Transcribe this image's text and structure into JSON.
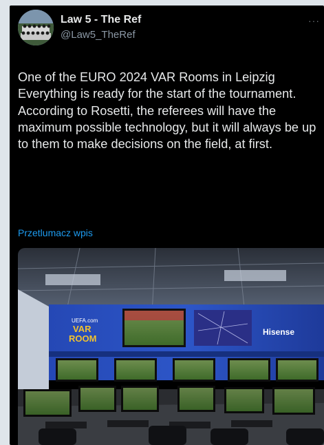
{
  "author": {
    "name": "Law 5 - The Ref",
    "handle": "@Law5_TheRef"
  },
  "more_label": "···",
  "tweet_text": "One of the EURO 2024 VAR Rooms in Leipzig\nEverything is ready for the start of the tournament.\nAccording to Rosetti, the referees will have the maximum possible technology, but it will always be up to them to make decisions on the field, at first.",
  "translate_link": "Przetlumacz wpis",
  "media": {
    "wall_text": {
      "uefa": "UEFA.com",
      "var_line1": "VAR",
      "var_line2": "ROOM",
      "brand": "Hisense"
    }
  },
  "colors": {
    "background": "#000000",
    "text": "#e7e9ea",
    "secondary": "#8b98a5",
    "link": "#1d9bf0",
    "wall_blue": "#1f3fa8"
  }
}
